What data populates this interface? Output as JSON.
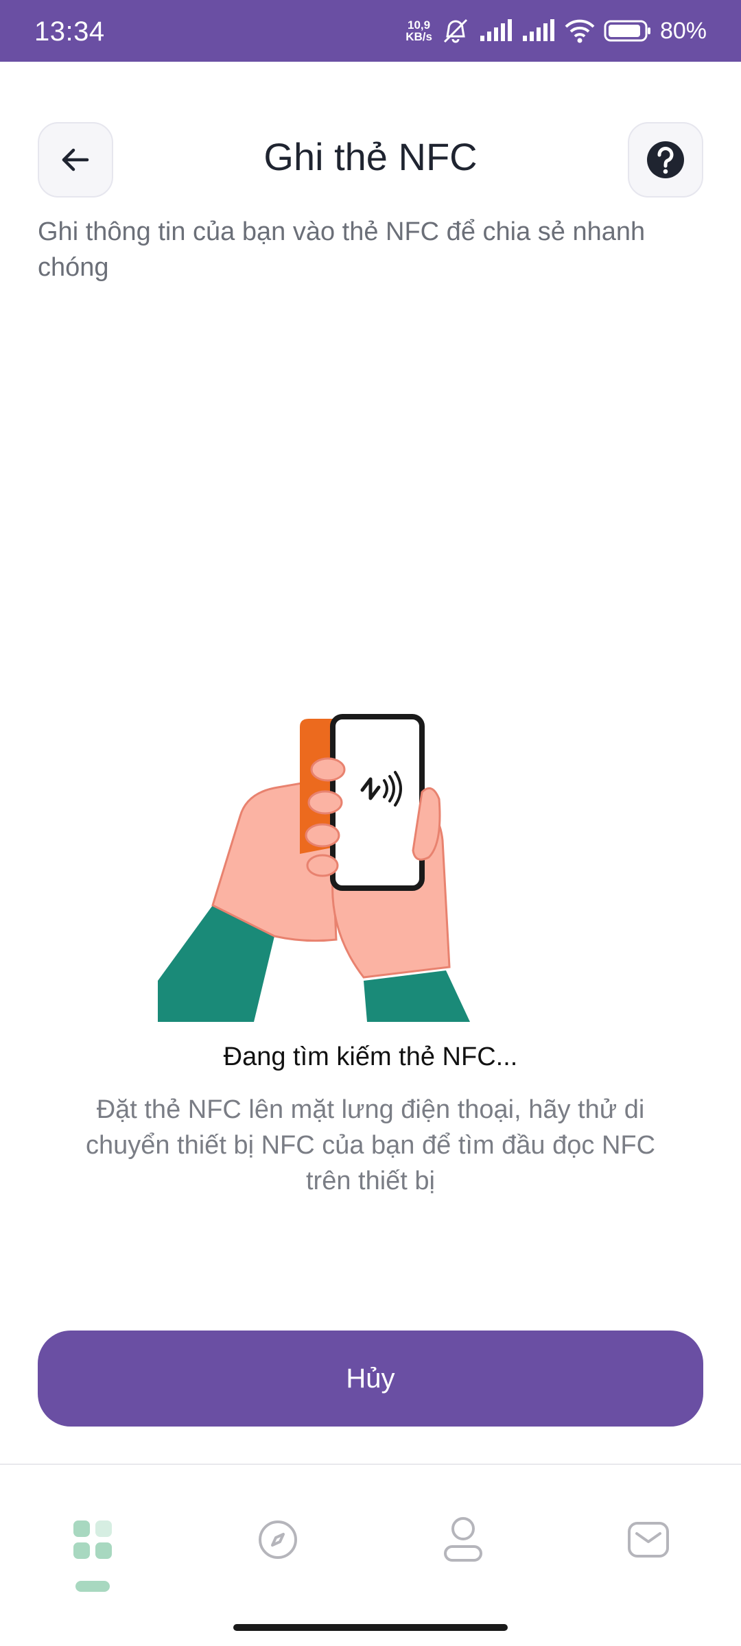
{
  "status_bar": {
    "time": "13:34",
    "net_speed_value": "10,9",
    "net_speed_unit": "KB/s",
    "battery_percent": "80%",
    "icons": [
      "alarm-off-icon",
      "signal-icon",
      "signal-icon",
      "wifi-icon",
      "battery-icon"
    ]
  },
  "header": {
    "title": "Ghi thẻ NFC",
    "back_icon": "arrow-left-icon",
    "help_icon": "question-circle-icon"
  },
  "subtitle": "Ghi thông tin của bạn vào thẻ NFC để chia sẻ nhanh chóng",
  "illustration": {
    "name": "hands-holding-phone-and-nfc-card",
    "colors": {
      "sleeve": "#1a8a78",
      "skin": "#fbb3a3",
      "card": "#ec6a1e",
      "phone_frame": "#1a1a1a"
    }
  },
  "search_status": "Đang tìm kiếm thẻ NFC...",
  "instructions": "Đặt thẻ NFC lên mặt lưng điện thoại, hãy thử di chuyển thiết bị NFC của bạn để tìm đầu đọc NFC trên thiết bị",
  "cancel_button": {
    "label": "Hủy"
  },
  "bottom_nav": {
    "items": [
      {
        "icon": "grid-icon",
        "active": true
      },
      {
        "icon": "compass-icon",
        "active": false
      },
      {
        "icon": "user-icon",
        "active": false
      },
      {
        "icon": "mail-icon",
        "active": false
      }
    ]
  },
  "colors": {
    "accent": "#6a4fa3",
    "nav_active": "#a8d8c0",
    "nav_inactive": "#b5b5bb"
  }
}
